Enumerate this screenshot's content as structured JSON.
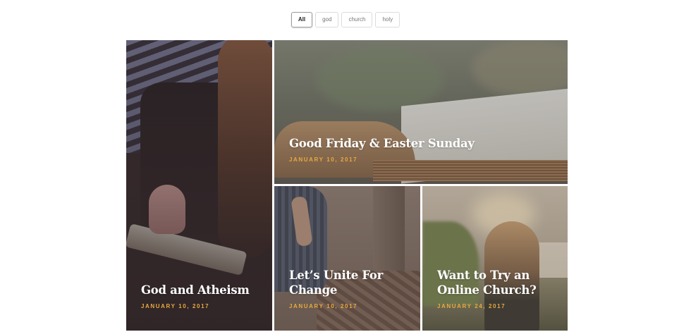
{
  "filters": {
    "items": [
      {
        "label": "All",
        "active": true
      },
      {
        "label": "god",
        "active": false
      },
      {
        "label": "church",
        "active": false
      },
      {
        "label": "holy",
        "active": false
      }
    ]
  },
  "gallery": {
    "cards": [
      {
        "title": "God and Atheism",
        "date": "JANUARY 10, 2017"
      },
      {
        "title": "Good Friday & Easter Sunday",
        "date": "JANUARY 10, 2017"
      },
      {
        "title": "Let’s Unite For Change",
        "date": "JANUARY 10, 2017"
      },
      {
        "title": "Want to Try an Online Church?",
        "date": "JANUARY 24, 2017"
      }
    ]
  },
  "colors": {
    "date_accent": "#e7a93f",
    "title_text": "#ffffff",
    "active_filter_border": "#9a9a9a"
  }
}
